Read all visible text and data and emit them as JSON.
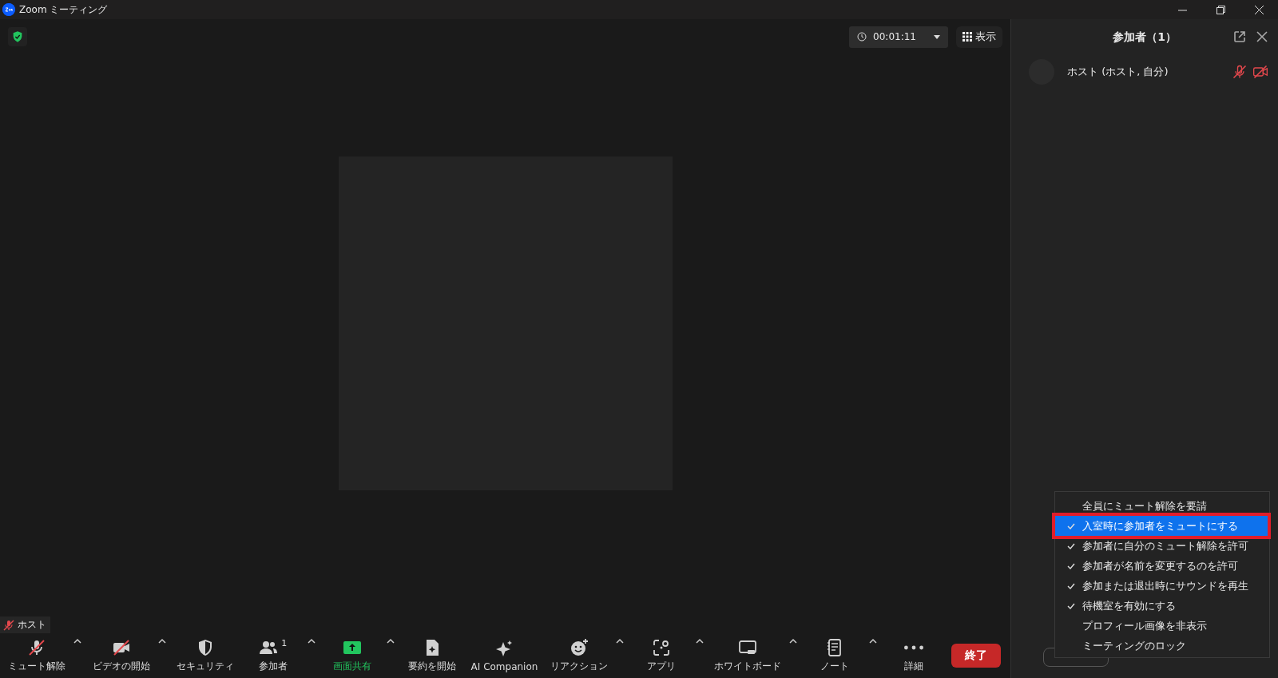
{
  "window": {
    "title": "Zoom ミーティング"
  },
  "top_bar": {
    "timer": "00:01:11",
    "view_button": "表示"
  },
  "self_label": {
    "name": "ホスト",
    "muted": true
  },
  "toolbar": [
    {
      "kind": "mic",
      "label": "ミュート解除",
      "caret": true,
      "off": true,
      "active": false
    },
    {
      "kind": "video",
      "label": "ビデオの開始",
      "caret": true,
      "off": true,
      "active": false
    },
    {
      "kind": "security",
      "label": "セキュリティ",
      "caret": false,
      "off": false,
      "active": false
    },
    {
      "kind": "participants",
      "label": "参加者",
      "badge": "1",
      "caret": true,
      "off": false,
      "active": false
    },
    {
      "kind": "share",
      "label": "画面共有",
      "caret": true,
      "off": false,
      "active": true
    },
    {
      "kind": "summary",
      "label": "要約を開始",
      "caret": false,
      "off": false,
      "active": false
    },
    {
      "kind": "ai",
      "label": "AI Companion",
      "caret": false,
      "off": false,
      "active": false
    },
    {
      "kind": "reaction",
      "label": "リアクション",
      "caret": true,
      "off": false,
      "active": false
    },
    {
      "kind": "apps",
      "label": "アプリ",
      "caret": true,
      "off": false,
      "active": false
    },
    {
      "kind": "whiteboard",
      "label": "ホワイトボード",
      "caret": true,
      "off": false,
      "active": false
    },
    {
      "kind": "notes",
      "label": "ノート",
      "caret": true,
      "off": false,
      "active": false
    },
    {
      "kind": "more",
      "label": "詳細",
      "caret": false,
      "off": false,
      "active": false
    }
  ],
  "end_button": "終了",
  "panel": {
    "title": "参加者（1）",
    "participants": [
      {
        "name": "ホスト (ホスト, 自分)",
        "muted": true,
        "video_off": true
      }
    ]
  },
  "menu": [
    {
      "label": "全員にミュート解除を要請",
      "checked": false,
      "selected": false
    },
    {
      "label": "入室時に参加者をミュートにする",
      "checked": true,
      "selected": true
    },
    {
      "label": "参加者に自分のミュート解除を許可",
      "checked": true,
      "selected": false
    },
    {
      "label": "参加者が名前を変更するのを許可",
      "checked": true,
      "selected": false
    },
    {
      "label": "参加または退出時にサウンドを再生",
      "checked": true,
      "selected": false
    },
    {
      "label": "待機室を有効にする",
      "checked": true,
      "selected": false
    },
    {
      "label": "プロフィール画像を非表示",
      "checked": false,
      "selected": false
    },
    {
      "label": "ミーティングのロック",
      "checked": false,
      "selected": false
    }
  ]
}
